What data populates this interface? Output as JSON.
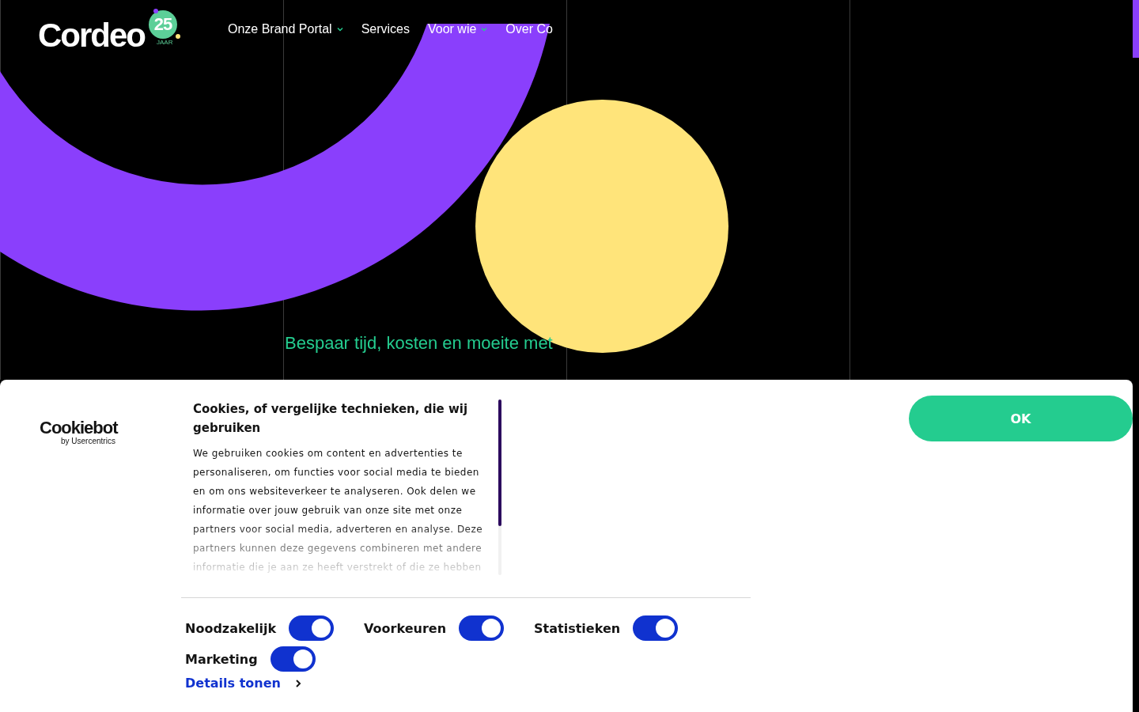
{
  "header": {
    "logo": {
      "name": "Cordeo",
      "badge": "25",
      "badge_caption": "JAAR"
    },
    "nav": [
      {
        "label": "Onze Brand Portal",
        "dropdown": true
      },
      {
        "label": "Services",
        "dropdown": false
      },
      {
        "label": "Voor wie",
        "dropdown": true
      },
      {
        "label": "Over Co",
        "dropdown": false
      }
    ]
  },
  "hero": {
    "tagline": "Bespaar tijd, kosten en moeite met"
  },
  "cookie_banner": {
    "brand": "Cookiebot",
    "brand_sub": "by Usercentrics",
    "title": "Cookies, of vergelijke technieken, die wij gebruiken",
    "text": "We gebruiken cookies om content en advertenties te personaliseren, om functies voor social media te bieden en om ons websiteverkeer te analyseren. Ook delen we informatie over jouw gebruik van onze site met onze partners voor social media, adverteren en analyse. Deze partners kunnen deze gegevens combineren met andere informatie die je aan ze heeft verstrekt of die ze hebben",
    "toggles": [
      {
        "label": "Noodzakelijk",
        "checked": true
      },
      {
        "label": "Voorkeuren",
        "checked": true
      },
      {
        "label": "Statistieken",
        "checked": true
      },
      {
        "label": "Marketing",
        "checked": true
      }
    ],
    "details_link": "Details tonen",
    "ok_button": "OK"
  }
}
